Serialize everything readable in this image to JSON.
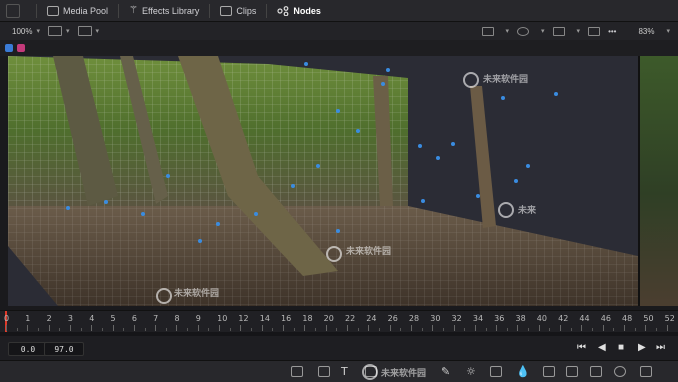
{
  "tabs": [
    {
      "label": "Media Pool",
      "icon": "media-pool-icon"
    },
    {
      "label": "Effects Library",
      "icon": "magic-wand-icon"
    },
    {
      "label": "Clips",
      "icon": "clips-icon"
    },
    {
      "label": "Nodes",
      "icon": "nodes-icon",
      "active": true
    }
  ],
  "viewer": {
    "zoom_left": "100%",
    "zoom_right": "83%",
    "more": "•••"
  },
  "watermarks": [
    "未来软件园",
    "未来软件园",
    "未来软件园",
    "未来软件园",
    "未来",
    "未来软件园"
  ],
  "ruler": {
    "labels": [
      "0",
      "1",
      "2",
      "3",
      "4",
      "5",
      "6",
      "7",
      "8",
      "9",
      "10",
      "12",
      "14",
      "16",
      "18",
      "20",
      "22",
      "24",
      "26",
      "28",
      "30",
      "32",
      "34",
      "36",
      "38",
      "40",
      "42",
      "44",
      "46",
      "48",
      "50",
      "52"
    ]
  },
  "transport": {
    "start_tc": "0.0",
    "end_tc": "97.0",
    "buttons": [
      "⏮",
      "◀",
      "■",
      "▶",
      "⏭"
    ]
  },
  "colors": {
    "accent": "#e03a2a",
    "chip1": "#3a7bd5",
    "chip2": "#d03a8a"
  }
}
